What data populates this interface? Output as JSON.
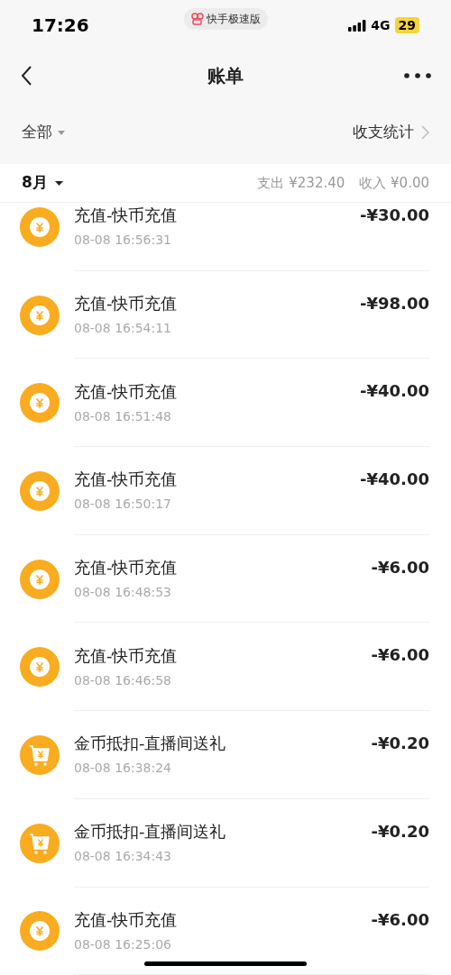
{
  "status_bar": {
    "time": "17:26",
    "app_badge": "快手极速版",
    "network": "4G",
    "battery": "29"
  },
  "nav": {
    "title": "账单"
  },
  "filter": {
    "label": "全部",
    "stats_link": "收支统计"
  },
  "month": {
    "label": "8月",
    "expense": "支出 ¥232.40",
    "income": "收入 ¥0.00"
  },
  "records": [
    {
      "kind": "recharge",
      "title": "充值-快币充值",
      "time": "08-08 16:56:31",
      "amount": "-¥30.00"
    },
    {
      "kind": "recharge",
      "title": "充值-快币充值",
      "time": "08-08 16:54:11",
      "amount": "-¥98.00"
    },
    {
      "kind": "recharge",
      "title": "充值-快币充值",
      "time": "08-08 16:51:48",
      "amount": "-¥40.00"
    },
    {
      "kind": "recharge",
      "title": "充值-快币充值",
      "time": "08-08 16:50:17",
      "amount": "-¥40.00"
    },
    {
      "kind": "recharge",
      "title": "充值-快币充值",
      "time": "08-08 16:48:53",
      "amount": "-¥6.00"
    },
    {
      "kind": "recharge",
      "title": "充值-快币充值",
      "time": "08-08 16:46:58",
      "amount": "-¥6.00"
    },
    {
      "kind": "coin",
      "title": "金币抵扣-直播间送礼",
      "time": "08-08 16:38:24",
      "amount": "-¥0.20"
    },
    {
      "kind": "coin",
      "title": "金币抵扣-直播间送礼",
      "time": "08-08 16:34:43",
      "amount": "-¥0.20"
    },
    {
      "kind": "recharge",
      "title": "充值-快币充值",
      "time": "08-08 16:25:06",
      "amount": "-¥6.00"
    }
  ]
}
